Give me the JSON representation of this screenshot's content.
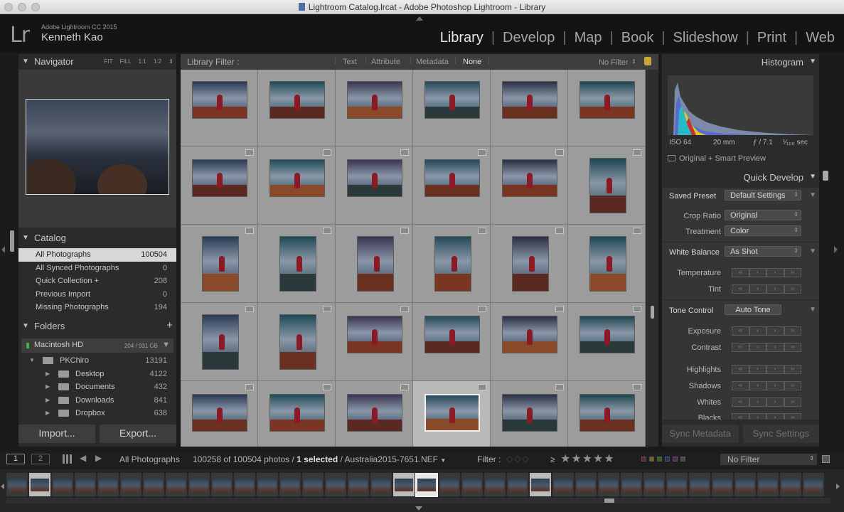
{
  "window": {
    "title": "Lightroom Catalog.lrcat - Adobe Photoshop Lightroom - Library"
  },
  "identity": {
    "logo": "Lr",
    "product": "Adobe Lightroom CC 2015",
    "user": "Kenneth Kao"
  },
  "modules": [
    {
      "label": "Library",
      "active": true
    },
    {
      "label": "Develop"
    },
    {
      "label": "Map"
    },
    {
      "label": "Book"
    },
    {
      "label": "Slideshow"
    },
    {
      "label": "Print"
    },
    {
      "label": "Web"
    }
  ],
  "navigator": {
    "title": "Navigator",
    "zoom": [
      "FIT",
      "FILL",
      "1:1",
      "1:2"
    ]
  },
  "catalog": {
    "title": "Catalog",
    "items": [
      {
        "label": "All Photographs",
        "count": "100504",
        "selected": true
      },
      {
        "label": "All Synced Photographs",
        "count": "0"
      },
      {
        "label": "Quick Collection  +",
        "count": "208"
      },
      {
        "label": "Previous Import",
        "count": "0"
      },
      {
        "label": "Missing Photographs",
        "count": "194"
      }
    ]
  },
  "folders": {
    "title": "Folders",
    "add": "+",
    "volume": {
      "name": "Macintosh HD",
      "size": "204 / 931 GB"
    },
    "items": [
      {
        "label": "PKChiro",
        "count": "13191",
        "level": 1,
        "expanded": true
      },
      {
        "label": "Desktop",
        "count": "4122",
        "level": 2
      },
      {
        "label": "Documents",
        "count": "432",
        "level": 2
      },
      {
        "label": "Downloads",
        "count": "841",
        "level": 2
      },
      {
        "label": "Dropbox",
        "count": "638",
        "level": 2
      }
    ]
  },
  "left_buttons": {
    "import": "Import...",
    "export": "Export..."
  },
  "library_filter": {
    "label": "Library Filter :",
    "options": [
      "Text",
      "Attribute",
      "Metadata",
      "None"
    ],
    "active": "None",
    "preset": "No Filter"
  },
  "histogram": {
    "title": "Histogram",
    "iso": "ISO 64",
    "focal": "20 mm",
    "aperture": "ƒ / 7.1",
    "shutter": "¹⁄₁₀₀ sec",
    "preview": "Original + Smart Preview"
  },
  "quick_develop": {
    "title": "Quick Develop",
    "saved_preset_label": "Saved Preset",
    "saved_preset_value": "Default Settings",
    "crop_label": "Crop Ratio",
    "crop_value": "Original",
    "treatment_label": "Treatment",
    "treatment_value": "Color",
    "wb_label": "White Balance",
    "wb_value": "As Shot",
    "temperature_label": "Temperature",
    "tint_label": "Tint",
    "tone_label": "Tone Control",
    "auto_tone": "Auto Tone",
    "exposure_label": "Exposure",
    "contrast_label": "Contrast",
    "highlights_label": "Highlights",
    "shadows_label": "Shadows",
    "whites_label": "Whites",
    "blacks_label": "Blacks"
  },
  "sync": {
    "metadata": "Sync Metadata",
    "settings": "Sync Settings"
  },
  "filmstrip_toolbar": {
    "page1": "1",
    "page2": "2",
    "source": "All Photographs",
    "count_prefix": "100258 of 100504 photos /",
    "selected": "1 selected",
    "filename": "/ Australia2015-7651.NEF",
    "filter_label": "Filter :",
    "filter_value": "No Filter",
    "rating_op": "≥",
    "stars": "★★★★★",
    "flags": "◇◇◇"
  },
  "grid": {
    "selected_index": 27
  }
}
